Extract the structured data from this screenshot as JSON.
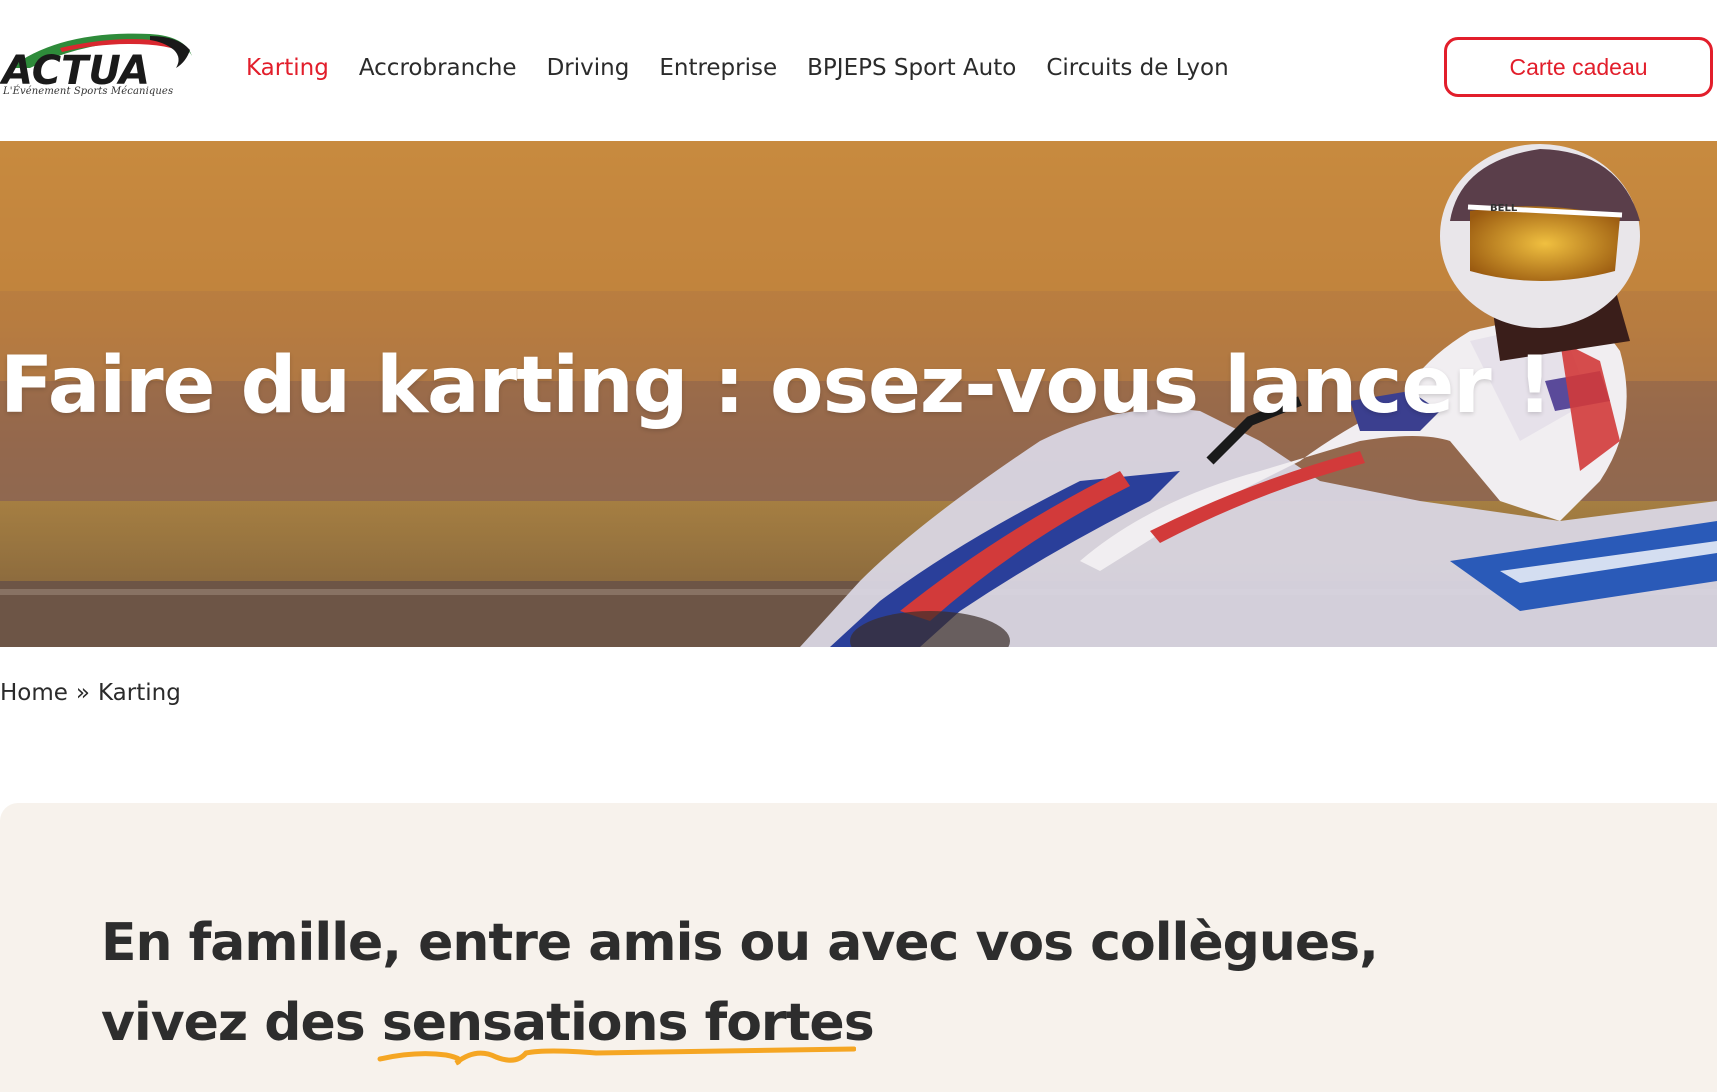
{
  "header": {
    "logo": {
      "text": "ACTUA",
      "tagline": "L'Événement Sports Mécaniques"
    },
    "nav": [
      {
        "label": "Karting",
        "active": true
      },
      {
        "label": "Accrobranche",
        "active": false
      },
      {
        "label": "Driving",
        "active": false
      },
      {
        "label": "Entreprise",
        "active": false
      },
      {
        "label": "BPJEPS Sport Auto",
        "active": false
      },
      {
        "label": "Circuits de Lyon",
        "active": false
      }
    ],
    "gift_button": "Carte cadeau"
  },
  "hero": {
    "title": "Faire du karting : osez-vous lancer !"
  },
  "breadcrumb": {
    "home": "Home",
    "separator": "»",
    "current": "Karting"
  },
  "intro": {
    "line1": "En famille, entre amis ou avec  vos collègues,",
    "line2_prefix": "vivez des ",
    "line2_highlight": "sensations fortes"
  },
  "colors": {
    "accent": "#e21e2b",
    "squiggle": "#f5a623",
    "section_bg": "#f7f2ec",
    "text": "#2b2b2b"
  }
}
